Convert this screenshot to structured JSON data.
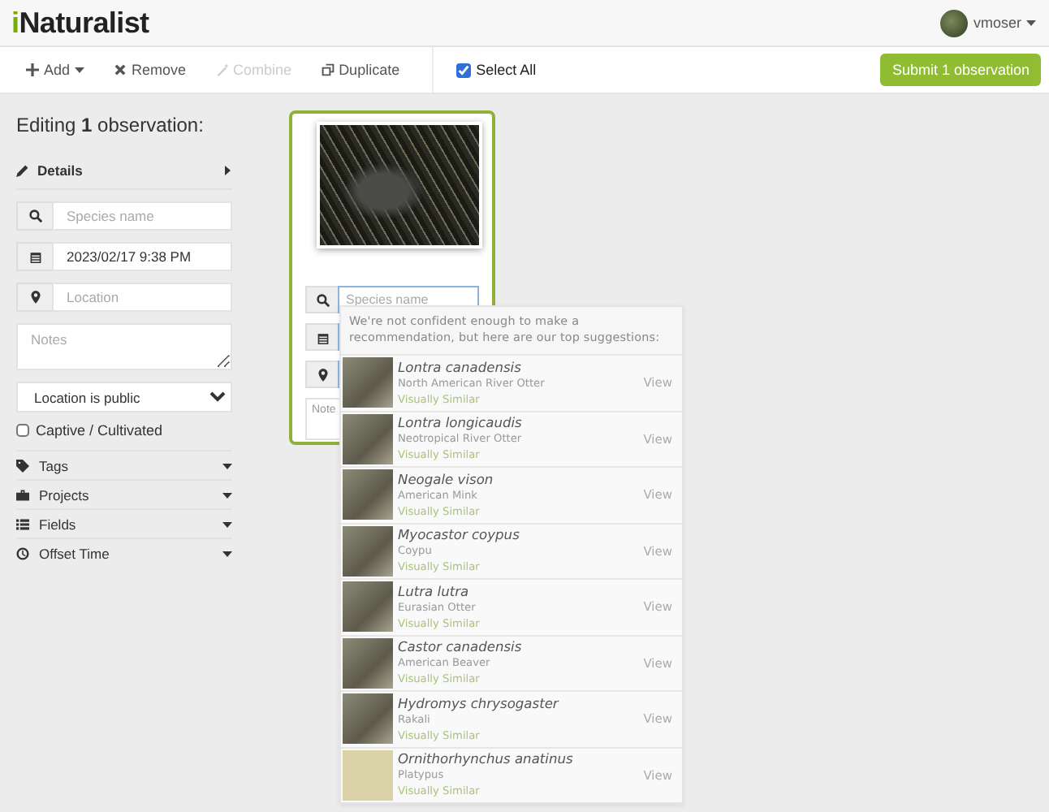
{
  "header": {
    "logo": "iNaturalist",
    "user": "vmoser"
  },
  "toolbar": {
    "buttons": [
      {
        "label": "Add",
        "disabled": false,
        "dropdown": true
      },
      {
        "label": "Remove",
        "disabled": false,
        "dropdown": false
      },
      {
        "label": "Combine",
        "disabled": true,
        "dropdown": false
      },
      {
        "label": "Duplicate",
        "disabled": false,
        "dropdown": false
      }
    ],
    "select_all": {
      "label": "Select All",
      "checked": true
    },
    "submit": "Submit 1 observation"
  },
  "sidebar": {
    "heading": "Editing **1** observation:",
    "details": "Details",
    "species_placeholder": "Species name",
    "date": "2023/02/17 9:38 PM",
    "location_placeholder": "Location",
    "notes_placeholder": "Notes",
    "geoprivacy": "Location is public",
    "captive": {
      "label": "Captive / Cultivated",
      "checked": false
    },
    "sections": [
      {
        "label": "Tags"
      },
      {
        "label": "Projects"
      },
      {
        "label": "Fields"
      },
      {
        "label": "Offset Time"
      }
    ]
  },
  "card": {
    "selected": true,
    "species_placeholder": "Species name",
    "notes_placeholder": "Note"
  },
  "suggestions": {
    "message": "We're not confident enough to make a recommendation, but here are our top suggestions:",
    "items": [
      {
        "name": "Lontra canadensis",
        "common": "North American River Otter",
        "reason": "Visually Similar",
        "action": "View"
      },
      {
        "name": "Lontra longicaudis",
        "common": "Neotropical River Otter",
        "reason": "Visually Similar",
        "action": "View"
      },
      {
        "name": "Neogale vison",
        "common": "American Mink",
        "reason": "Visually Similar",
        "action": "View"
      },
      {
        "name": "Myocastor coypus",
        "common": "Coypu",
        "reason": "Visually Similar",
        "action": "View"
      },
      {
        "name": "Lutra lutra",
        "common": "Eurasian Otter",
        "reason": "Visually Similar",
        "action": "View"
      },
      {
        "name": "Castor canadensis",
        "common": "American Beaver",
        "reason": "Visually Similar",
        "action": "View"
      },
      {
        "name": "Hydromys chrysogaster",
        "common": "Rakali",
        "reason": "Visually Similar",
        "action": "View"
      },
      {
        "name": "Ornithorhynchus anatinus",
        "common": "Platypus",
        "reason": "Visually Similar",
        "action": "View"
      }
    ]
  }
}
